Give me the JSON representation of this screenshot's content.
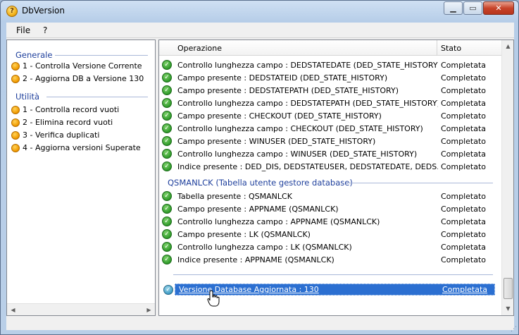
{
  "window": {
    "title": "DbVersion",
    "app_icon": "?"
  },
  "menu": [
    {
      "label": "File"
    },
    {
      "label": "?"
    }
  ],
  "left_panel": {
    "groups": [
      {
        "title": "Generale",
        "items": [
          "1 - Controlla Versione Corrente",
          "2 - Aggiorna DB a Versione 130"
        ]
      },
      {
        "title": "Utilità",
        "items": [
          "1 - Controlla record vuoti",
          "2 - Elimina record vuoti",
          "3 - Verifica duplicati",
          "4 - Aggiorna versioni Superate"
        ]
      }
    ]
  },
  "table": {
    "columns": {
      "operation": "Operazione",
      "status": "Stato"
    },
    "rows_part1": [
      {
        "op": "Controllo lunghezza campo  : DEDSTATEDATE (DED_STATE_HISTORY)",
        "status": "Completata"
      },
      {
        "op": "Campo presente : DEDSTATEID (DED_STATE_HISTORY)",
        "status": "Completato"
      },
      {
        "op": "Campo presente : DEDSTATEPATH (DED_STATE_HISTORY)",
        "status": "Completato"
      },
      {
        "op": "Controllo lunghezza campo  : DEDSTATEPATH (DED_STATE_HISTORY)",
        "status": "Completata"
      },
      {
        "op": "Campo presente : CHECKOUT (DED_STATE_HISTORY)",
        "status": "Completato"
      },
      {
        "op": "Controllo lunghezza campo  : CHECKOUT (DED_STATE_HISTORY)",
        "status": "Completata"
      },
      {
        "op": "Campo presente : WINUSER (DED_STATE_HISTORY)",
        "status": "Completato"
      },
      {
        "op": "Controllo lunghezza campo  : WINUSER (DED_STATE_HISTORY)",
        "status": "Completata"
      },
      {
        "op": "Indice presente : DED_DIS, DEDSTATEUSER, DEDSTATEDATE, DEDS...",
        "status": "Completato"
      }
    ],
    "section_title": "QSMANLCK (Tabella utente gestore database)",
    "rows_part2": [
      {
        "op": "Tabella presente : QSMANLCK",
        "status": "Completato"
      },
      {
        "op": "Campo presente : APPNAME (QSMANLCK)",
        "status": "Completato"
      },
      {
        "op": "Controllo lunghezza campo  : APPNAME (QSMANLCK)",
        "status": "Completata"
      },
      {
        "op": "Campo presente : LK (QSMANLCK)",
        "status": "Completato"
      },
      {
        "op": "Controllo lunghezza campo   : LK (QSMANLCK)",
        "status": "Completata"
      },
      {
        "op": "Indice presente : APPNAME (QSMANLCK)",
        "status": "Completato"
      }
    ],
    "selected_row": {
      "op": "Versione Database Aggiornata : 130",
      "status": "Completata"
    }
  },
  "colors": {
    "accent": "#2b6fd1",
    "group_title": "#1e3f9c",
    "success": "#2f9a2a"
  }
}
